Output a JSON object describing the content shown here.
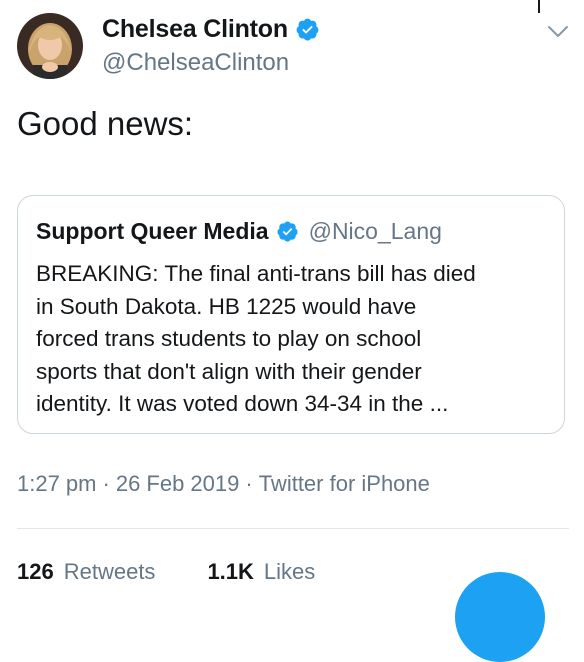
{
  "colors": {
    "accent": "#1da1f2",
    "secondary_text": "#657786",
    "primary_text": "#14171a",
    "border": "#ccd6dd"
  },
  "author": {
    "name": "Chelsea Clinton",
    "handle": "@ChelseaClinton",
    "verified_icon": "verified-badge-icon",
    "avatar_icon": "profile-photo"
  },
  "menu_icon": "chevron-down-icon",
  "tweet": {
    "text": "Good news:"
  },
  "quoted_tweet": {
    "name": "Support Queer Media",
    "handle": "@Nico_Lang",
    "verified_icon": "verified-badge-icon",
    "text": "BREAKING: The final anti-trans bill has died\nin South Dakota. HB 1225 would have\nforced trans students to play on school\nsports that don't align with their gender\nidentity. It was voted down 34-34 in the ..."
  },
  "meta": {
    "time": "1:27 pm",
    "separator": "·",
    "date": "26 Feb 2019",
    "source": "Twitter for iPhone"
  },
  "stats": {
    "retweets_count": "126",
    "retweets_label": "Retweets",
    "likes_count": "1.1K",
    "likes_label": "Likes"
  },
  "compose_button_icon": "compose-fab"
}
